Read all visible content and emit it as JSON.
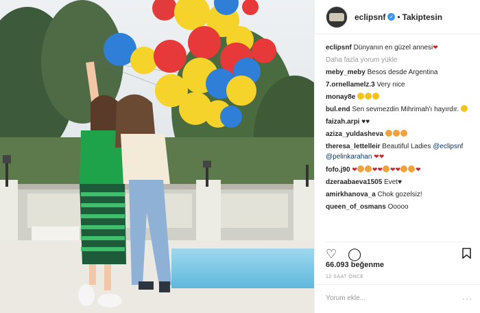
{
  "photo": {
    "alt": ""
  },
  "header": {
    "username": "eclipsnf",
    "follow_label": "Takiptesin"
  },
  "comments": [
    {
      "user": "eclipsnf",
      "text": "Dünyanın en güzel annesi"
    },
    {
      "more_label": "Daha fazla yorum yükle"
    },
    {
      "user": "meby_meby",
      "text": "Besos desde Argentina"
    },
    {
      "user": "7.ornellamelz.3",
      "text": "Very nice"
    },
    {
      "user": "monay8e",
      "text": ""
    },
    {
      "user": "bul.end",
      "text": "Sen sevmezdin Mihrimah'ı hayırdır."
    },
    {
      "user": "faizah.arpi",
      "text": "♥♥"
    },
    {
      "user": "aziza_yuldasheva",
      "text": ""
    },
    {
      "user": "theresa_lettelleir",
      "text": "Beautiful Ladies",
      "mention1": "@eclipsnf",
      "mention2": "@pelinkarahan"
    },
    {
      "user": "fofo.j90",
      "text": ""
    },
    {
      "user": "dzeraabaeva1505",
      "text": "Evet♥"
    },
    {
      "user": "amirkhanova_a",
      "text": "Chok gozelsiz!"
    },
    {
      "user": "queen_of_osmans",
      "text": "Ooooo"
    }
  ],
  "actions": {
    "like_icon": "heart-outline",
    "comment_icon": "speech-bubble",
    "save_icon": "bookmark"
  },
  "likes": {
    "count": "66.093",
    "label": "beğenme"
  },
  "timestamp": "12 SAAT ÖNCE",
  "add_comment": {
    "placeholder": "Yorum ekle...",
    "options": "···"
  },
  "colors": {
    "accent": "#3897f0",
    "text": "#262626",
    "muted": "#999999",
    "link": "#003569"
  }
}
